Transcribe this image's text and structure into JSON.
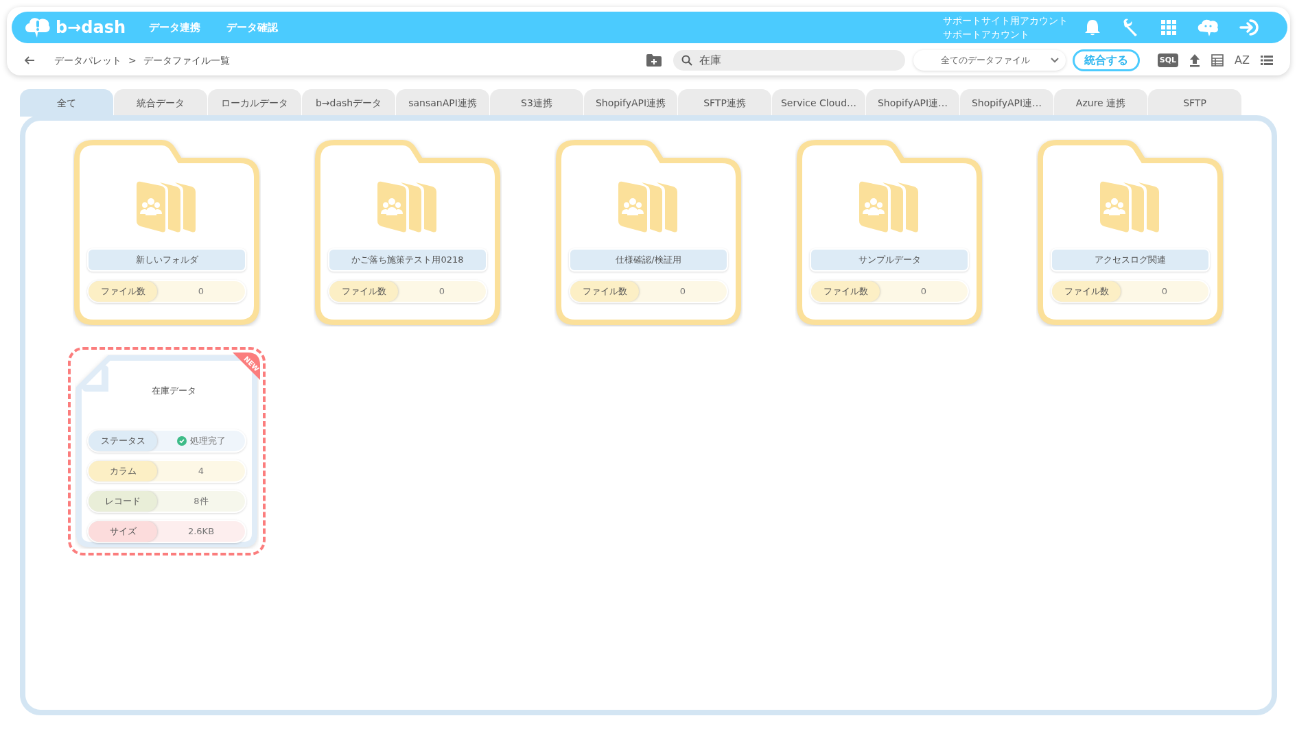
{
  "header": {
    "logo": "b→dash",
    "nav": [
      {
        "label": "データ連携"
      },
      {
        "label": "データ確認"
      }
    ],
    "account": {
      "site": "サポートサイト用アカウント",
      "name": "サポートアカウント"
    }
  },
  "toolbar": {
    "breadcrumb": [
      "データパレット",
      "データファイル一覧"
    ],
    "separator": ">",
    "search": {
      "value": "在庫"
    },
    "filter": {
      "value": "全てのデータファイル"
    },
    "merge_button": "統合する",
    "sql_label": "SQL",
    "sort_label": "AZ"
  },
  "tabs": [
    {
      "label": "全て",
      "selected": true
    },
    {
      "label": "統合データ",
      "selected": false
    },
    {
      "label": "ローカルデータ",
      "selected": false
    },
    {
      "label": "b→dashデータ",
      "selected": false
    },
    {
      "label": "sansanAPI連携",
      "selected": false
    },
    {
      "label": "S3連携",
      "selected": false
    },
    {
      "label": "ShopifyAPI連携",
      "selected": false
    },
    {
      "label": "SFTP連携",
      "selected": false
    },
    {
      "label": "Service Cloud…",
      "selected": false
    },
    {
      "label": "ShopifyAPI連…",
      "selected": false
    },
    {
      "label": "ShopifyAPI連…",
      "selected": false
    },
    {
      "label": "Azure 連携",
      "selected": false
    },
    {
      "label": "SFTP",
      "selected": false
    }
  ],
  "items": [
    {
      "kind": "folder",
      "name": "新しいフォルダ",
      "rows": [
        {
          "kind": "count",
          "label": "ファイル数",
          "value": "0"
        }
      ]
    },
    {
      "kind": "folder",
      "name": "かご落ち施策テスト用0218",
      "rows": [
        {
          "kind": "count",
          "label": "ファイル数",
          "value": "0"
        }
      ]
    },
    {
      "kind": "folder",
      "name": "仕様確認/検証用",
      "rows": [
        {
          "kind": "count",
          "label": "ファイル数",
          "value": "0"
        }
      ]
    },
    {
      "kind": "folder",
      "name": "サンプルデータ",
      "rows": [
        {
          "kind": "count",
          "label": "ファイル数",
          "value": "0"
        }
      ]
    },
    {
      "kind": "folder",
      "name": "アクセスログ関連",
      "rows": [
        {
          "kind": "count",
          "label": "ファイル数",
          "value": "0"
        }
      ]
    },
    {
      "kind": "file",
      "name": "在庫データ",
      "badge": "NEW",
      "selected": true,
      "rows": [
        {
          "kind": "status",
          "label": "ステータス",
          "value": "処理完了"
        },
        {
          "kind": "count",
          "label": "カラム",
          "value": "4"
        },
        {
          "kind": "record",
          "label": "レコード",
          "value": "8件"
        },
        {
          "kind": "size",
          "label": "サイズ",
          "value": "2.6KB"
        }
      ]
    }
  ]
}
